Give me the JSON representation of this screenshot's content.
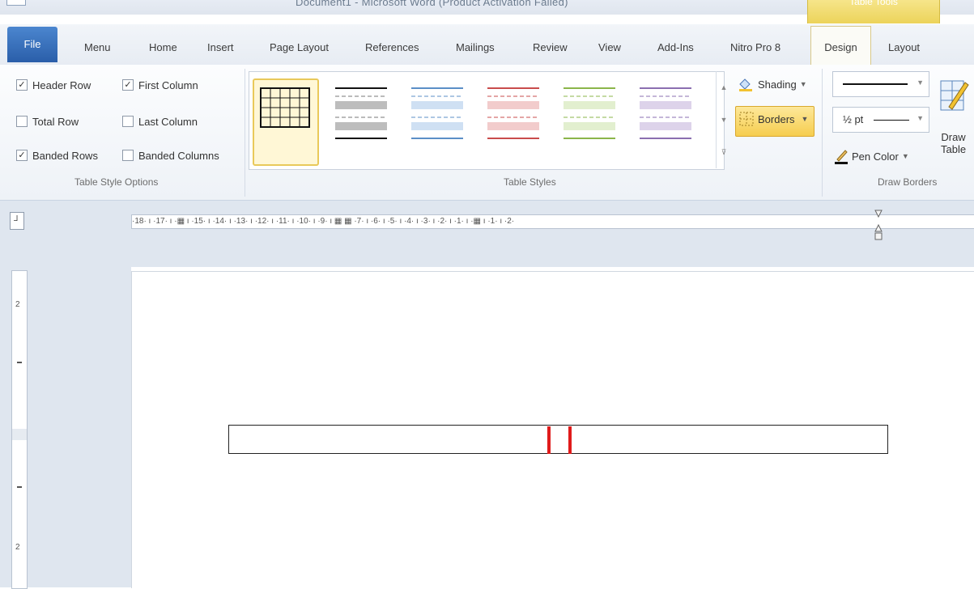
{
  "window": {
    "title": "Document1 - Microsoft Word (Product Activation Failed)",
    "contextual_header": "Table Tools"
  },
  "tabs": [
    {
      "label": "File"
    },
    {
      "label": "Menu"
    },
    {
      "label": "Home"
    },
    {
      "label": "Insert"
    },
    {
      "label": "Page Layout"
    },
    {
      "label": "References"
    },
    {
      "label": "Mailings"
    },
    {
      "label": "Review"
    },
    {
      "label": "View"
    },
    {
      "label": "Add-Ins"
    },
    {
      "label": "Nitro Pro 8"
    },
    {
      "label": "Design"
    },
    {
      "label": "Layout"
    }
  ],
  "active_tab": "Design",
  "table_style_options": {
    "label": "Table Style Options",
    "options": [
      {
        "label": "Header Row",
        "checked": true
      },
      {
        "label": "First Column",
        "checked": true
      },
      {
        "label": "Total Row",
        "checked": false
      },
      {
        "label": "Last Column",
        "checked": false
      },
      {
        "label": "Banded Rows",
        "checked": true
      },
      {
        "label": "Banded Columns",
        "checked": false
      }
    ]
  },
  "table_styles": {
    "label": "Table Styles",
    "styles": [
      {
        "color": "#222222",
        "selected": true
      },
      {
        "color": "#222222"
      },
      {
        "color": "#5b8fc7"
      },
      {
        "color": "#c94c4c"
      },
      {
        "color": "#8bb54a"
      },
      {
        "color": "#8b6fb0"
      }
    ],
    "shading_label": "Shading",
    "borders_label": "Borders"
  },
  "draw_borders": {
    "label": "Draw Borders",
    "pen_weight": "½ pt",
    "pen_color_label": "Pen Color",
    "draw_table_label": "Draw Table",
    "draw_table_line1": "Draw",
    "draw_table_line2": "Table"
  },
  "ruler": {
    "text": "·18· ı ·17· ı ·▦ ı ·15· ı ·14· ı ·13· ı ·12· ı ·11· ı ·10· ı ·9· ı ▦ ▦ ·7· ı ·6· ı ·5· ı ·4· ı ·3· ı ·2· ı ·1· ı ·▦ ı ·1· ı ·2·"
  },
  "vruler_labels": [
    "2",
    "1",
    "1",
    "2"
  ],
  "colors": {
    "accent_file": "#2a5ea9",
    "table_tools": "#ecd35a",
    "highlight": "#f6cd4f",
    "red_marker": "#e01b1b"
  }
}
